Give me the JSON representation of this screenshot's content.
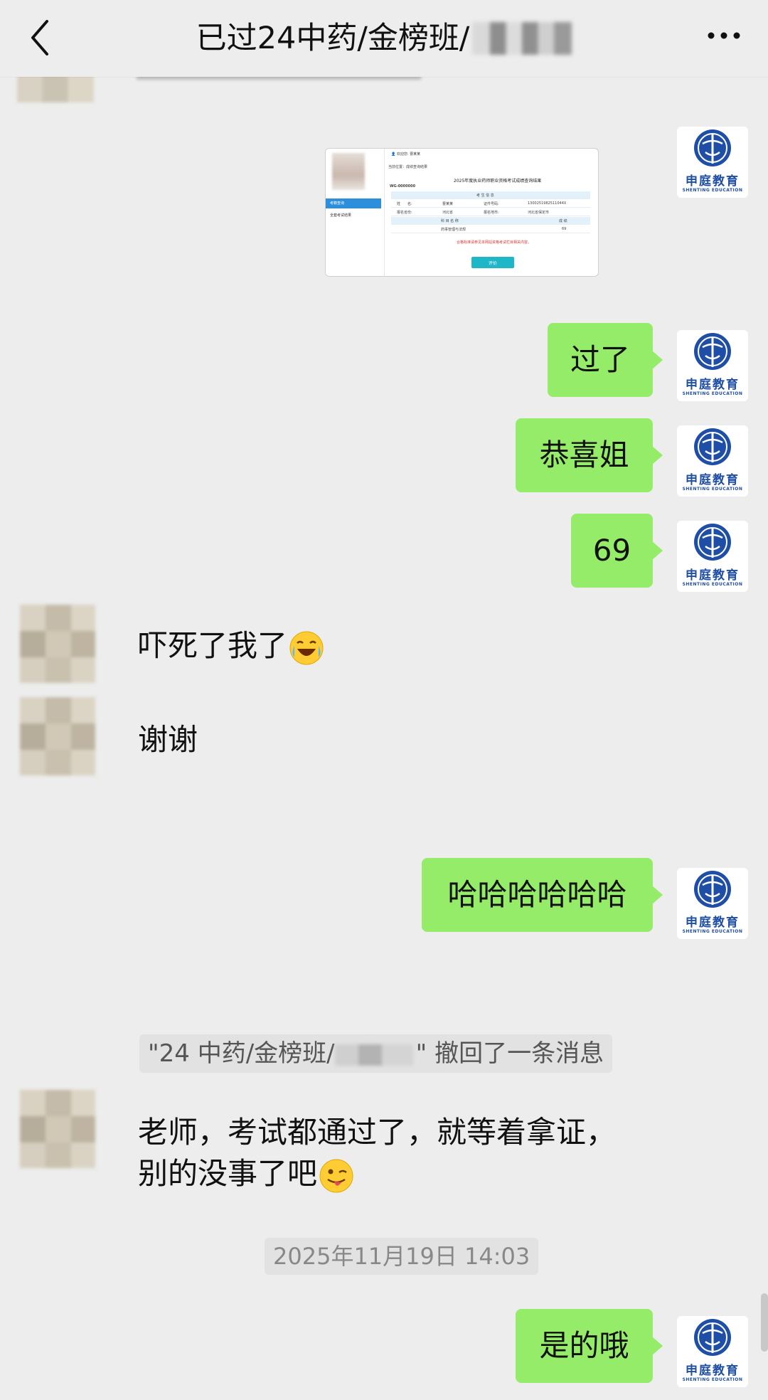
{
  "header": {
    "title": "已过24中药/金榜班/",
    "back_icon": "chevron-left-icon",
    "more_icon": "more-dots-icon"
  },
  "me": {
    "org_name_cn": "申庭教育",
    "org_name_en": "SHENTING EDUCATION",
    "bubble_color": "#95ec69"
  },
  "score_screenshot": {
    "breadcrumb": "当前位置：成绩查询结果",
    "title": "2025年度执业药师职业资格考试成绩查询结果",
    "ticket": "WG-0000000",
    "section_info": "考 生 信 息",
    "label_name": "姓　　名:",
    "value_name": "曹某某",
    "label_id": "证件号码:",
    "value_id": "1300251982511044X",
    "label_region": "报名省份:",
    "value_region": "河北省",
    "label_city": "报名地市:",
    "value_city": "河北省保定市",
    "section_subject": "科 目 名 称",
    "section_result": "成 绩",
    "subject": "药事管理与法规",
    "score": "69",
    "notice": "合格标准请参见本网站资格考试栏目相关内容。",
    "button": "评价",
    "menu_1": "考籍查询",
    "menu_2": "全套考试结果"
  },
  "messages": [
    {
      "from": "me",
      "text": "过了"
    },
    {
      "from": "me",
      "text": "恭喜姐"
    },
    {
      "from": "me",
      "text": "69"
    },
    {
      "from": "other",
      "text": "吓死了我了",
      "emoji": "crying-laughing-emoji"
    },
    {
      "from": "other",
      "text": "谢谢"
    },
    {
      "from": "me",
      "text": "哈哈哈哈哈哈"
    },
    {
      "from": "system",
      "prefix": "\"24 中药/金榜班/",
      "suffix": "\" 撤回了一条消息"
    },
    {
      "from": "other",
      "line1": "老师，考试都通过了，就等着拿证，",
      "line2": "别的没事了吧",
      "emoji": "winking-tongue-emoji"
    },
    {
      "from": "system",
      "text": "2025年11月19日 14:03"
    },
    {
      "from": "me",
      "text": "是的哦"
    }
  ]
}
